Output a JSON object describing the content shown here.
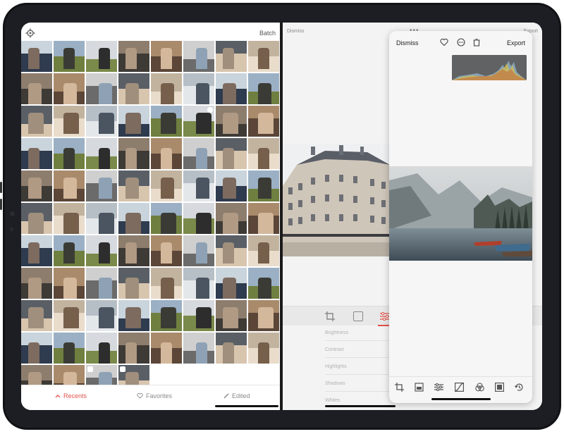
{
  "photos": {
    "batch_label": "Batch",
    "tabs": [
      {
        "label": "Recents",
        "icon": "chevron-up-icon",
        "active": true
      },
      {
        "label": "Favorites",
        "icon": "heart-icon",
        "active": false
      },
      {
        "label": "Edited",
        "icon": "pencil-icon",
        "active": false
      }
    ],
    "accent_color": "#e0534a"
  },
  "editor": {
    "dismiss_label": "Dismiss",
    "export_label": "Export",
    "more_icon": "ellipsis-icon",
    "adjustments": [
      "Brightness",
      "Contrast",
      "Highlights",
      "Shadows",
      "Whites"
    ]
  },
  "card": {
    "dismiss_label": "Dismiss",
    "export_label": "Export",
    "icons": [
      "heart-icon",
      "ellipsis-circle-icon",
      "trash-icon"
    ],
    "toolbar_icons": [
      "crop-icon",
      "filter-icon",
      "sliders-icon",
      "curves-icon",
      "color-icon",
      "frame-icon",
      "history-icon"
    ]
  }
}
